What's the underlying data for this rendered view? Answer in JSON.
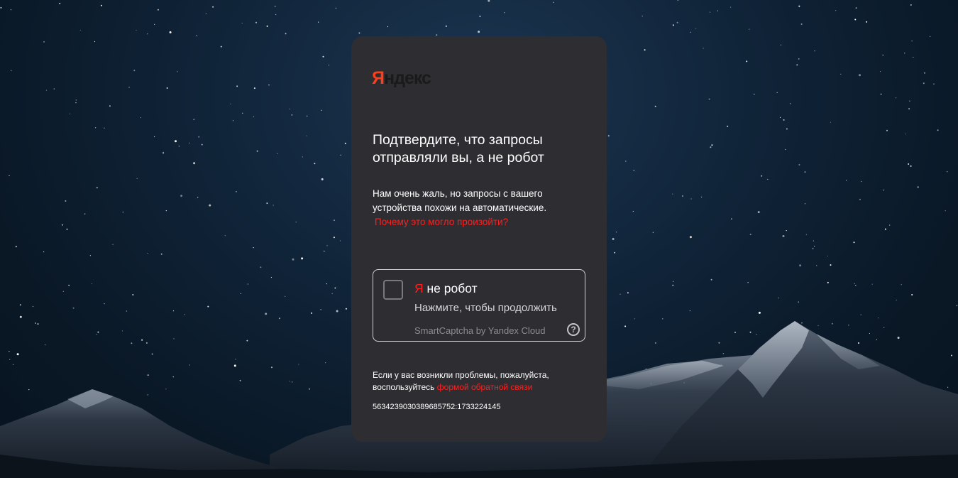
{
  "logo": {
    "first_letter": "Я",
    "rest": "ндекс"
  },
  "title": "Подтвердите, что запросы отправляли вы, а не робот",
  "description": {
    "text": "Нам очень жаль, но запросы с вашего устройства похожи на автоматические.",
    "link": "Почему это могло произойти?"
  },
  "captcha": {
    "title_prefix": "Я",
    "title_rest": "не робот",
    "subtitle": "Нажмите, чтобы продолжить",
    "brand": "SmartCaptcha by Yandex Cloud",
    "help_icon": "question-circle-icon",
    "help_symbol": "?"
  },
  "footer": {
    "text": "Если у вас возникли проблемы, пожалуйста, воспользуйтесь",
    "link": "формой обратной связи"
  },
  "request_id": "5634239030389685752:1733224145",
  "colors": {
    "card_background": "#2e2d31",
    "accent_red": "#ff1f1f",
    "logo_red": "#fc3f1d",
    "logo_dark": "#1a1a1a"
  }
}
